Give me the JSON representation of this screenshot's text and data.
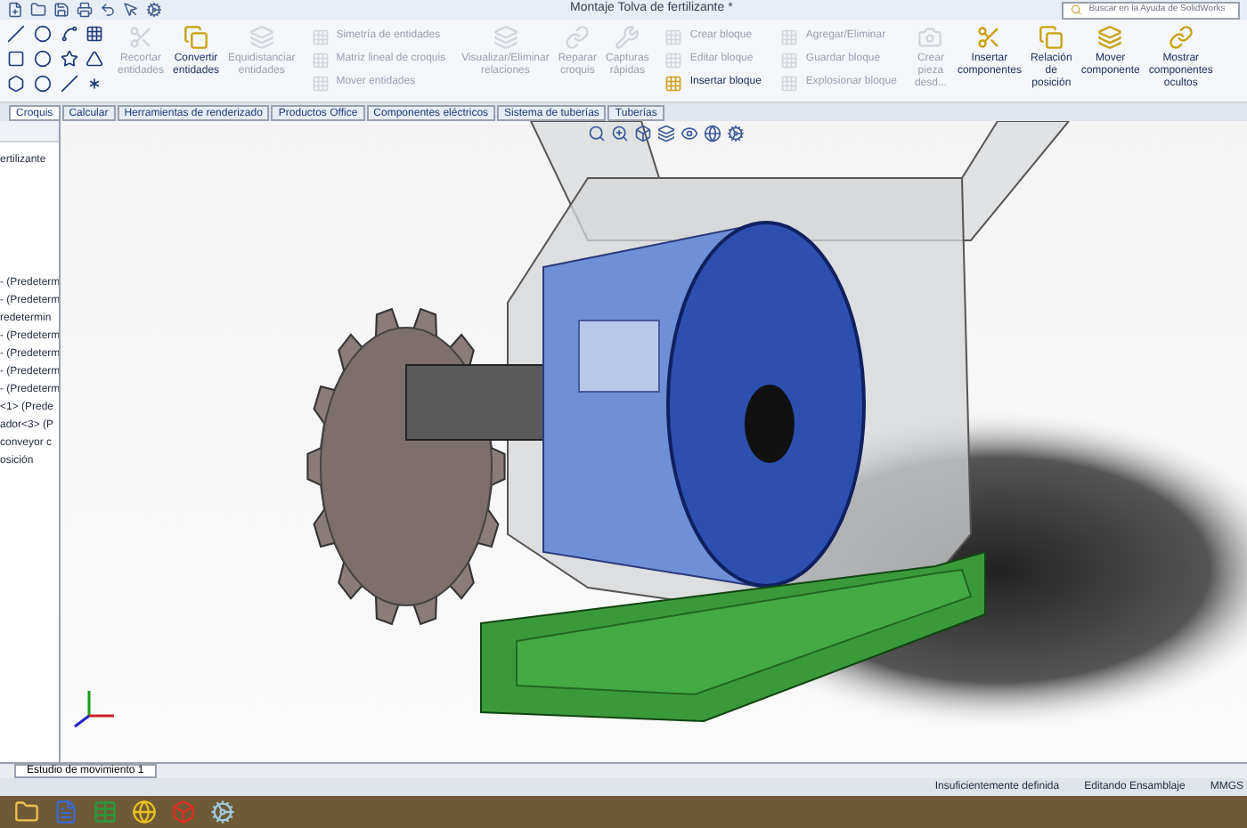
{
  "title_bar": {
    "title": "Montaje Tolva de fertilizante *",
    "search": {
      "placeholder": "Buscar en la Ayuda de SolidWorks"
    }
  },
  "ribbon": {
    "groups": [
      {
        "kind": "large",
        "items": [
          {
            "label": "Recortar entidades",
            "disabled": true
          },
          {
            "label": "Convertir entidades",
            "disabled": false
          },
          {
            "label": "Equidistanciar entidades",
            "disabled": true
          }
        ]
      },
      {
        "kind": "list",
        "items": [
          {
            "label": "Simetría de entidades",
            "disabled": true
          },
          {
            "label": "Matriz lineal de croquis",
            "disabled": true
          },
          {
            "label": "Mover entidades",
            "disabled": true
          }
        ]
      },
      {
        "kind": "large",
        "items": [
          {
            "label": "Visualizar/Eliminar relaciones",
            "disabled": true
          },
          {
            "label": "Reparar croquis",
            "disabled": true
          },
          {
            "label": "Capturas rápidas",
            "disabled": true
          }
        ]
      },
      {
        "kind": "list",
        "items": [
          {
            "label": "Crear bloque",
            "disabled": true
          },
          {
            "label": "Editar bloque",
            "disabled": true
          },
          {
            "label": "Insertar bloque",
            "disabled": false
          }
        ]
      },
      {
        "kind": "list",
        "items": [
          {
            "label": "Agregar/Eliminar",
            "disabled": true
          },
          {
            "label": "Guardar bloque",
            "disabled": true
          },
          {
            "label": "Explosionar bloque",
            "disabled": true
          }
        ]
      },
      {
        "kind": "large",
        "items": [
          {
            "label": "Crear pieza desd...",
            "disabled": true
          },
          {
            "label": "Insertar componentes",
            "disabled": false
          },
          {
            "label": "Relación de posición",
            "disabled": false
          },
          {
            "label": "Mover componente",
            "disabled": false
          },
          {
            "label": "Mostrar componentes ocultos",
            "disabled": false
          }
        ]
      }
    ]
  },
  "tabs": [
    {
      "label": "Croquis",
      "selected": true
    },
    {
      "label": "Calcular",
      "selected": false
    },
    {
      "label": "Herramientas de renderizado",
      "selected": false
    },
    {
      "label": "Productos Office",
      "selected": false
    },
    {
      "label": "Componentes eléctricos",
      "selected": false
    },
    {
      "label": "Sistema de tuberías",
      "selected": false
    },
    {
      "label": "Tuberías",
      "selected": false
    }
  ],
  "tree": {
    "root": "ertilizante",
    "items": [
      "- (Predeterm",
      "- (Predeterm",
      "redetermin",
      "- (Predeterm",
      "- (Predeterm",
      "- (Predeterm",
      "- (Predeterm",
      "<1> (Prede",
      "ador<3> (P",
      "conveyor c",
      "osición"
    ]
  },
  "bottom_tabs": [
    {
      "label": "Estudio de movimiento 1",
      "selected": true
    }
  ],
  "status_bar": [
    "Insuficientemente definida",
    "Editando Ensamblaje",
    "MMGS"
  ]
}
